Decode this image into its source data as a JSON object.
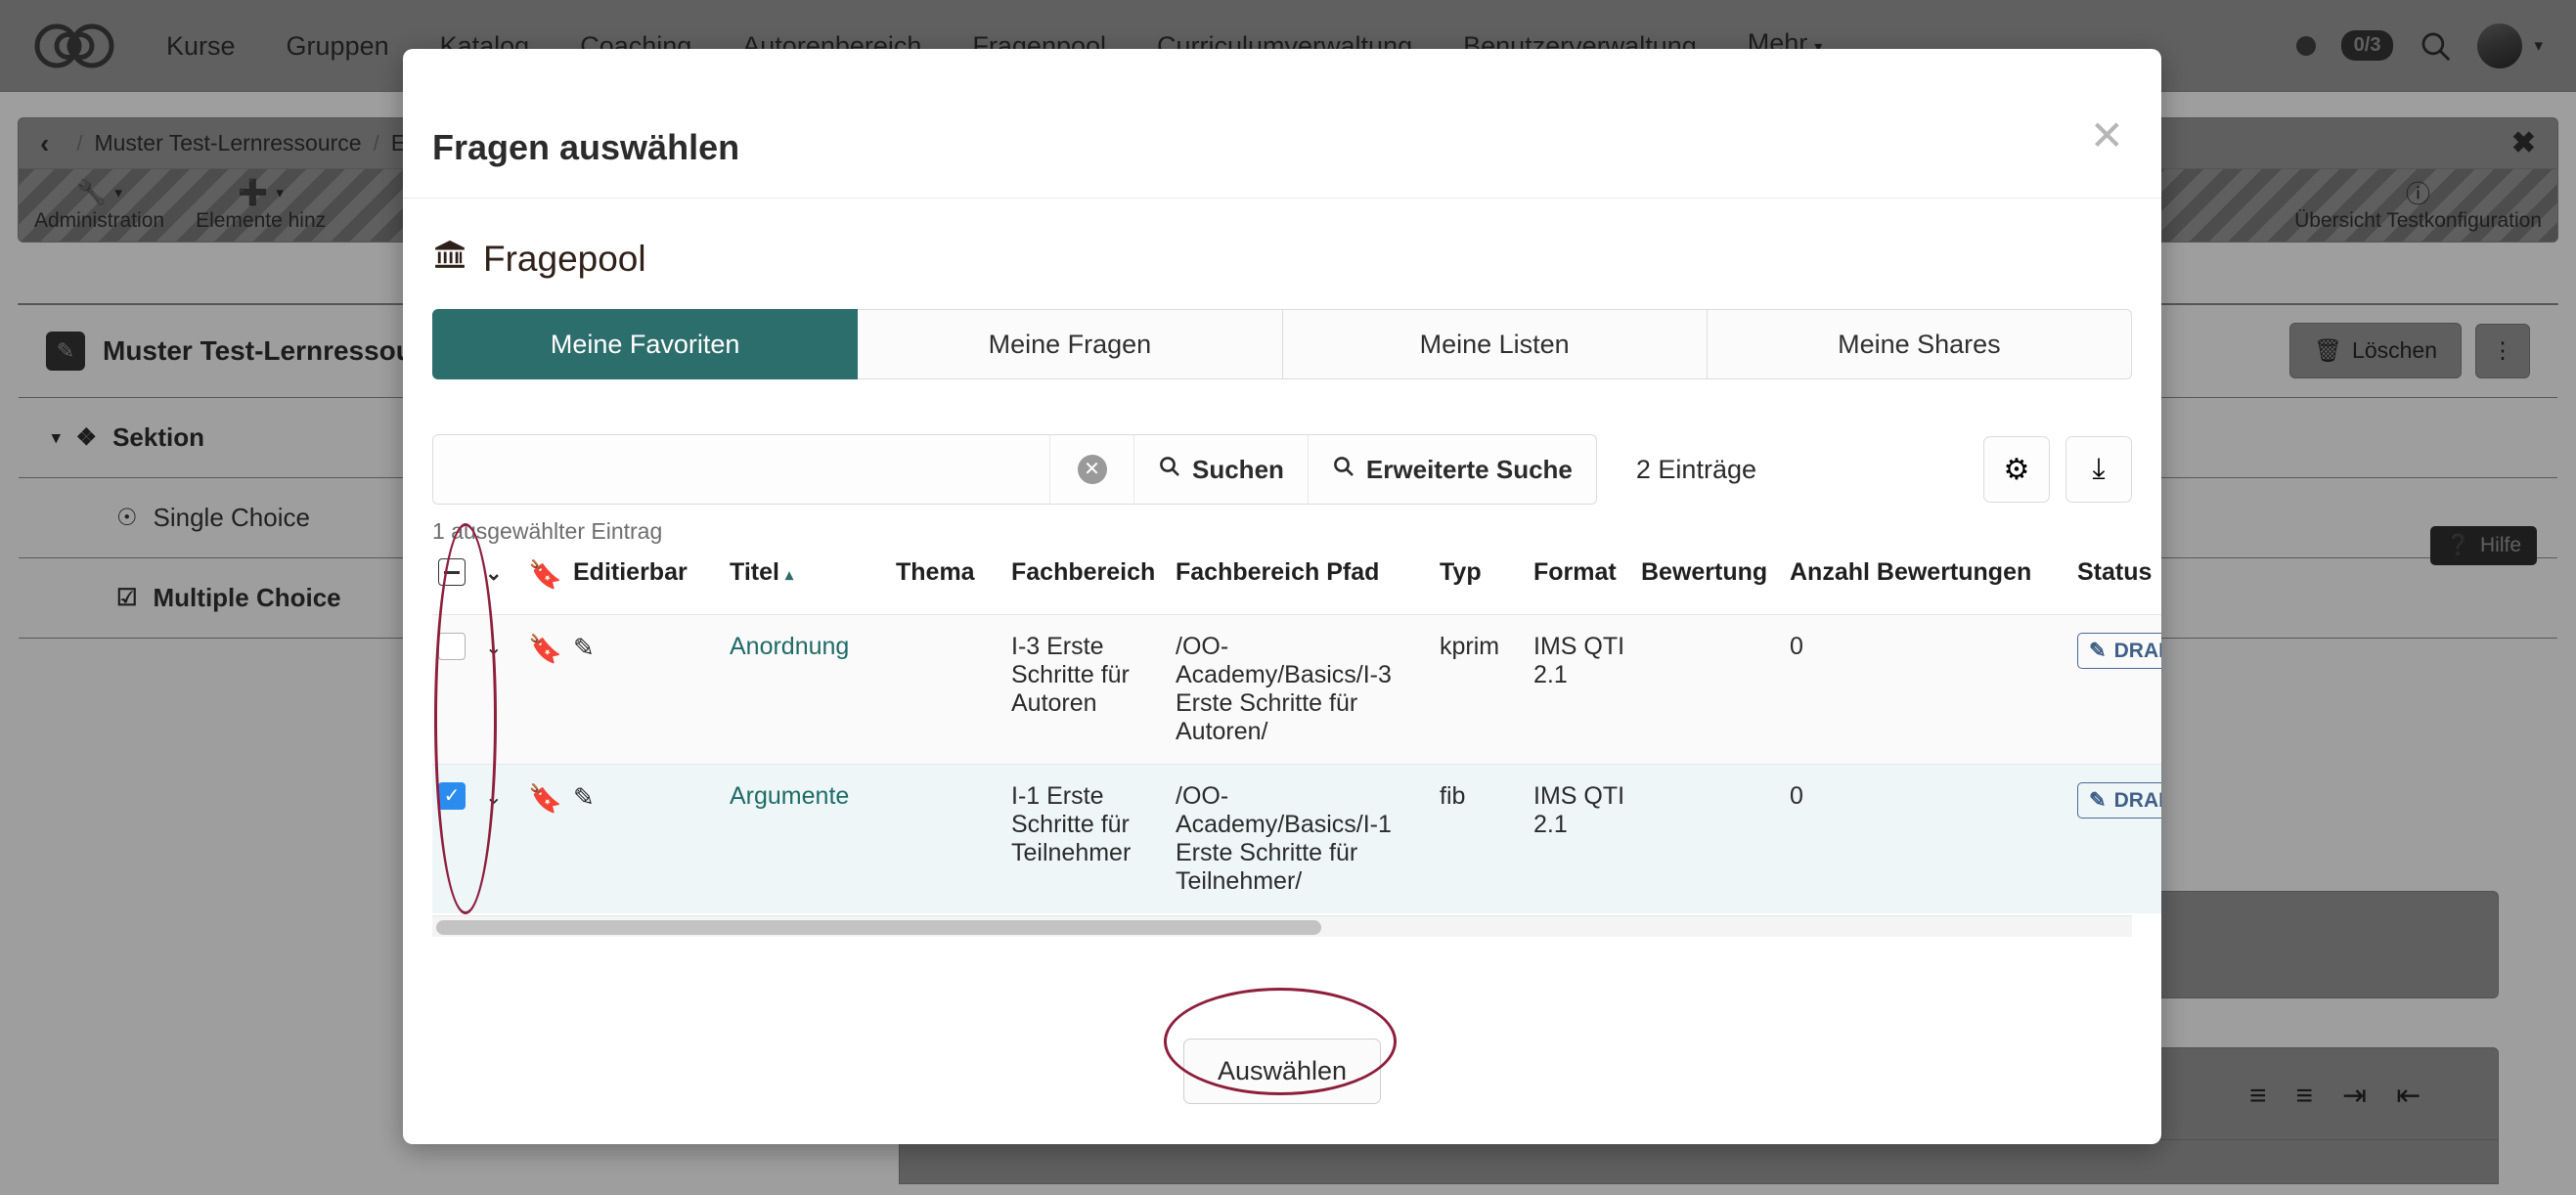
{
  "topnav": {
    "logo_name": "openolat-infinity-logo",
    "items": [
      {
        "label": "Kurse"
      },
      {
        "label": "Gruppen"
      },
      {
        "label": "Katalog"
      },
      {
        "label": "Coaching"
      },
      {
        "label": "Autorenbereich"
      },
      {
        "label": "Fragenpool"
      },
      {
        "label": "Curriculumverwaltung"
      },
      {
        "label": "Benutzerverwaltung"
      },
      {
        "label": "Mehr"
      }
    ],
    "more_caret": "▾",
    "status_counter": "0/3",
    "avatar_caret": "▾"
  },
  "breadcrumb": {
    "back": "‹",
    "sep": "/",
    "items": [
      "Muster Test-Lernressource",
      "Ed"
    ],
    "close": "✖"
  },
  "toolbar": {
    "items": [
      {
        "label": "Administration",
        "icon": "wrench-icon",
        "glyph": "🔧",
        "caret": "▾"
      },
      {
        "label": "Elemente hinz",
        "icon": "plus-circle-icon",
        "glyph": "➕",
        "caret": "▾"
      }
    ],
    "right_item": {
      "label": "Übersicht Testkonfiguration",
      "icon": "info-icon",
      "glyph": "i"
    }
  },
  "content_card": {
    "title": "Muster Test-Lernressourc",
    "title_icon": "pencil-square-icon",
    "delete_label": "Löschen",
    "delete_icon": "trash-icon",
    "more_icon": "kebab-menu-icon",
    "tree": [
      {
        "label": "Sektion",
        "level": 0,
        "caret": "▾",
        "icon": "❖",
        "selected": false
      },
      {
        "label": "Single Choice",
        "level": 1,
        "icon": "☉",
        "selected": false
      },
      {
        "label": "Multiple Choice",
        "level": 1,
        "icon": "☑",
        "selected": true
      }
    ],
    "help_label": "Hilfe",
    "help_icon": "question-circle-icon",
    "editor_icons": [
      "bullet-list-icon",
      "numbered-list-icon",
      "indent-icon",
      "outdent-icon"
    ]
  },
  "modal": {
    "title": "Fragen auswählen",
    "close_icon": "✕",
    "pool": {
      "heading": "Fragepool",
      "icon": "bank-icon",
      "glyph": "🏛"
    },
    "tabs": [
      {
        "label": "Meine Favoriten",
        "active": true
      },
      {
        "label": "Meine Fragen",
        "active": false
      },
      {
        "label": "Meine Listen",
        "active": false
      },
      {
        "label": "Meine Shares",
        "active": false
      }
    ],
    "search": {
      "value": "",
      "placeholder": "",
      "clear_icon": "✕",
      "search_label": "Suchen",
      "advanced_label": "Erweiterte Suche",
      "search_icon": "search-icon",
      "entries_label": "2 Einträge",
      "settings_icon": "gear-icon",
      "download_icon": "download-icon"
    },
    "selection_text": "1 ausgewählter Eintrag",
    "table": {
      "columns": [
        {
          "label": "",
          "name": "select-all"
        },
        {
          "label": "",
          "name": "expand"
        },
        {
          "label": "",
          "name": "bookmark"
        },
        {
          "label": "Editierbar"
        },
        {
          "label": "Titel",
          "sorted": "asc",
          "sort_caret": "▴"
        },
        {
          "label": "Thema"
        },
        {
          "label": "Fachbereich"
        },
        {
          "label": "Fachbereich Pfad"
        },
        {
          "label": "Typ"
        },
        {
          "label": "Format"
        },
        {
          "label": "Bewertung"
        },
        {
          "label": "Anzahl Bewertungen"
        },
        {
          "label": "Status"
        }
      ],
      "rows": [
        {
          "checked": false,
          "chevron": "⌄",
          "bookmark": "⚑",
          "edit_icon": "edit-square-icon",
          "titel": "Anordnung",
          "thema": "",
          "fachbereich": "I-3 Erste Schritte für Autoren",
          "fachbereich_pfad": "/OO-Academy/Basics/I-3 Erste Schritte für Autoren/",
          "typ": "kprim",
          "format": "IMS QTI 2.1",
          "bewertung": "",
          "anzahl_bewertungen": "0",
          "status": "DRAFT",
          "status_icon": "pencil-icon"
        },
        {
          "checked": true,
          "chevron": "⌄",
          "bookmark": "⚑",
          "edit_icon": "edit-square-icon",
          "titel": "Argumente",
          "thema": "",
          "fachbereich": "I-1 Erste Schritte für Teilnehmer",
          "fachbereich_pfad": "/OO-Academy/Basics/I-1 Erste Schritte für Teilnehmer/",
          "typ": "fib",
          "format": "IMS QTI 2.1",
          "bewertung": "",
          "anzahl_bewertungen": "0",
          "status": "DRAFT",
          "status_icon": "pencil-icon"
        }
      ]
    },
    "footer": {
      "select_label": "Auswählen"
    }
  },
  "colors": {
    "brand_teal": "#2c6e6b",
    "dark_teal": "#12494a",
    "annotation": "#8e1f3c",
    "selected_row": "#eef6f8",
    "checkbox_blue": "#2b8cf0",
    "draft_blue": "#3f5f87",
    "close_red": "#b92020"
  }
}
